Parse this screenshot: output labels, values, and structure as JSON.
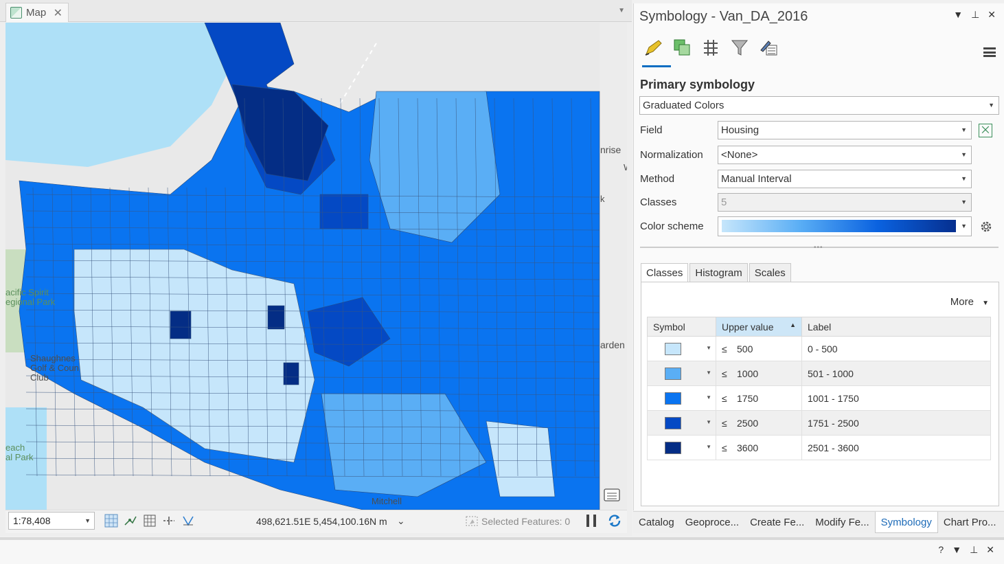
{
  "map_pane": {
    "tab_label": "Map",
    "map_labels": {
      "pacific_spirit": "acific Spirit\negional Park",
      "shaughnessy": "Shaughnes\nGolf & Coun\nClub",
      "beach": "each\nal Park",
      "sunrise": "nrise",
      "gardens": "arden",
      "mitchell": "Mitchell",
      "w_letter": "W",
      "k_letter": "k"
    },
    "status": {
      "scale": "1:78,408",
      "coordinates": "498,621.51E 5,454,100.16N m",
      "selected_features": "Selected Features: 0"
    }
  },
  "symbology": {
    "title": "Symbology - Van_DA_2016",
    "primary_heading": "Primary symbology",
    "renderer": "Graduated Colors",
    "fields": {
      "field_label": "Field",
      "field_value": "Housing",
      "normalization_label": "Normalization",
      "normalization_value": "<None>",
      "method_label": "Method",
      "method_value": "Manual Interval",
      "classes_label": "Classes",
      "classes_value": "5",
      "color_scheme_label": "Color scheme"
    },
    "tabs": [
      "Classes",
      "Histogram",
      "Scales"
    ],
    "more_label": "More",
    "table": {
      "headers": [
        "Symbol",
        "Upper value",
        "Label"
      ],
      "rows": [
        {
          "color": "#c6e6fb",
          "le": "≤",
          "upper": "500",
          "label": "0 - 500"
        },
        {
          "color": "#5aaef5",
          "le": "≤",
          "upper": "1000",
          "label": "501 - 1000"
        },
        {
          "color": "#0a74f0",
          "le": "≤",
          "upper": "1750",
          "label": "1001 - 1750"
        },
        {
          "color": "#0449c4",
          "le": "≤",
          "upper": "2500",
          "label": "1751 - 2500"
        },
        {
          "color": "#042d85",
          "le": "≤",
          "upper": "3600",
          "label": "2501 - 3600"
        }
      ]
    }
  },
  "bottom_tabs": [
    "Catalog",
    "Geoproce...",
    "Create Fe...",
    "Modify Fe...",
    "Symbology",
    "Chart Pro..."
  ],
  "lower_pane": {
    "help": "?"
  },
  "colors": {
    "water": "#aee0f7",
    "land": "#e9e9e9",
    "park": "#c9dec0",
    "class_1": "#c6e6fb",
    "class_2": "#5aaef5",
    "class_3": "#0a74f0",
    "class_4": "#0449c4",
    "class_5": "#042d85",
    "accent": "#0a6dc2"
  }
}
